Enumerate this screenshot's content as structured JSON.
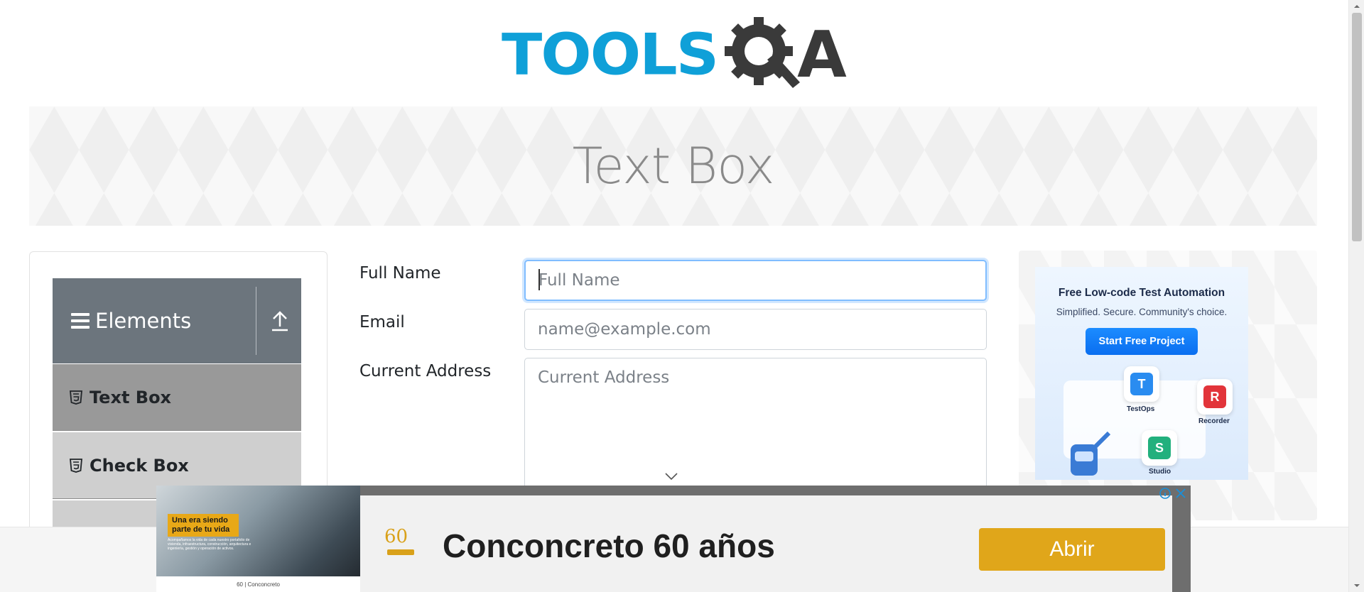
{
  "logo": {
    "text_part": "TOOLS",
    "trailing_letter": "A",
    "brand_color": "#0fa0d8",
    "dark_color": "#3a3a3a"
  },
  "banner": {
    "title": "Text Box"
  },
  "sidebar": {
    "group_label": "Elements",
    "items": [
      {
        "label": "Text Box",
        "active": true
      },
      {
        "label": "Check Box",
        "active": false
      }
    ]
  },
  "form": {
    "full_name": {
      "label": "Full Name",
      "placeholder": "Full Name",
      "value": ""
    },
    "email": {
      "label": "Email",
      "placeholder": "name@example.com",
      "value": ""
    },
    "current_address": {
      "label": "Current Address",
      "placeholder": "Current Address",
      "value": ""
    }
  },
  "right_ad": {
    "title": "Free Low-code Test Automation",
    "subtitle": "Simplified. Secure. Community's choice.",
    "button": "Start Free Project",
    "products": [
      {
        "name": "TestOps",
        "letter": "T",
        "color": "#2a8cf0"
      },
      {
        "name": "Recorder",
        "letter": "R",
        "color": "#e2343a"
      },
      {
        "name": "Studio",
        "letter": "S",
        "color": "#22b07d"
      }
    ]
  },
  "bottom_ad": {
    "photo_tag": "Una era siendo parte de tu vida",
    "photo_small_text": "Acompañamos la vida de cada nuestro portafolio de vivienda, infraestructura, construcción, arquitectura e ingeniería, gestión y operación de activos.",
    "photo_footer": "60 | Conconcreto",
    "brand_number": "60",
    "headline": "Conconcreto 60 años",
    "cta": "Abrir",
    "cta_color": "#e0a61a"
  },
  "icons": {
    "hamburger": "hamburger-icon",
    "collapse": "collapse-arrow-icon",
    "html5": "html5-icon",
    "ad_info": "info-icon",
    "ad_close": "close-icon",
    "resize": "chevron-down-icon"
  }
}
